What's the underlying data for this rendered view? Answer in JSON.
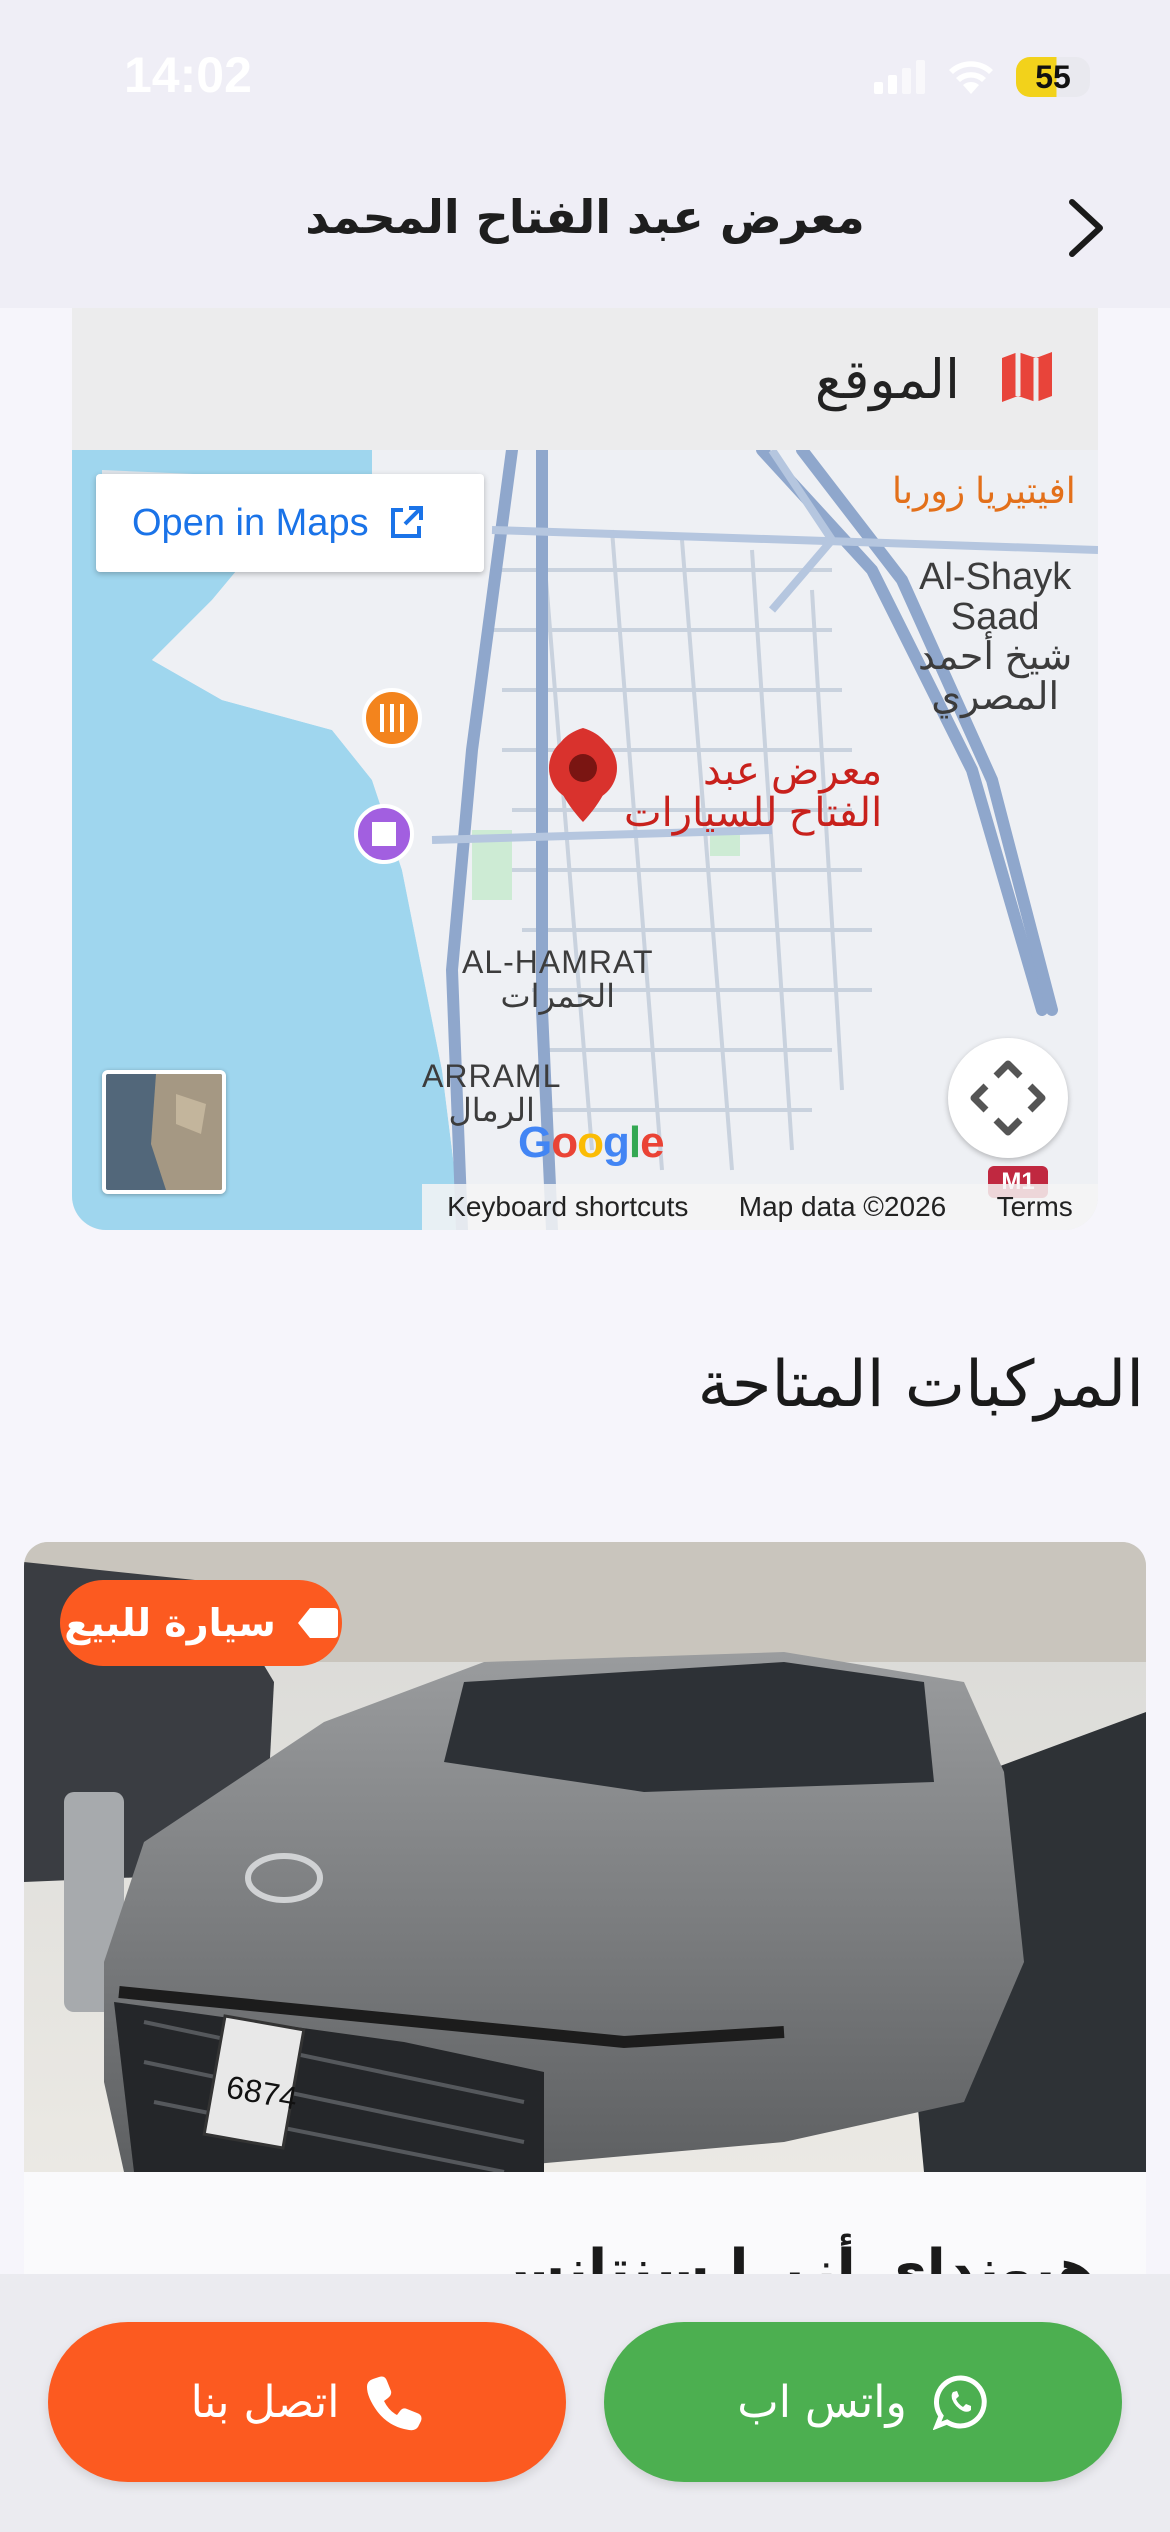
{
  "status_bar": {
    "time": "14:02",
    "battery": "55"
  },
  "header": {
    "title": "معرض عبد الفتاح المحمد"
  },
  "location": {
    "title": "الموقع",
    "map": {
      "open_in_maps": "Open in Maps",
      "pin_label_line1": "معرض عبد",
      "pin_label_line2": "الفتاح للسيارات",
      "area_alhamrat_en": "AL-HAMRAT",
      "area_alhamrat_ar": "الحمرات",
      "area_arraml_en": "ARRAML",
      "area_arraml_ar": "الرمال",
      "poi_top_right": "افيتيريا زوربا",
      "poi_shayk_en_1": "Al-Shayk",
      "poi_shayk_en_2": "Saad",
      "poi_shayk_ar_1": "شيخ أحمد",
      "poi_shayk_ar_2": "المصري",
      "google": "Google",
      "footer_keyboard": "Keyboard shortcuts",
      "footer_mapdata": "Map data ©2026",
      "footer_terms": "Terms",
      "road_badge": "M1"
    }
  },
  "vehicles": {
    "section_title": "المركبات المتاحة",
    "items": [
      {
        "badge": "سيارة للبيع",
        "name": "هيونداي أزيرا سنتانس",
        "plate": "6874"
      }
    ]
  },
  "actions": {
    "call_label": "اتصل بنا",
    "whatsapp_label": "واتس اب"
  },
  "colors": {
    "accent_orange": "#fc5a20",
    "whatsapp_green": "#4caf50",
    "map_pin_red": "#d9322d",
    "link_blue": "#1a73e8"
  }
}
